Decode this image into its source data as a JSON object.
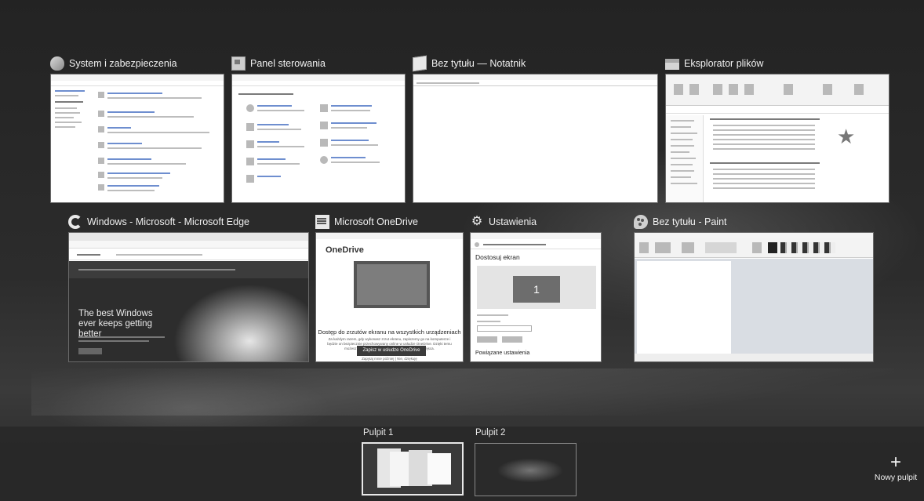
{
  "windows": [
    {
      "title": "System i zabezpieczenia",
      "icon": "shield-icon"
    },
    {
      "title": "Panel sterowania",
      "icon": "control-panel-icon"
    },
    {
      "title": "Bez tytułu — Notatnik",
      "icon": "notepad-icon"
    },
    {
      "title": "Eksplorator plików",
      "icon": "folder-icon"
    },
    {
      "title": "Windows - Microsoft - Microsoft Edge",
      "icon": "edge-icon"
    },
    {
      "title": "Microsoft OneDrive",
      "icon": "onedrive-icon"
    },
    {
      "title": "Ustawienia",
      "icon": "gear-icon"
    },
    {
      "title": "Bez tytułu - Paint",
      "icon": "paint-icon"
    }
  ],
  "edge_thumb": {
    "hero_title": "The best Windows ever keeps getting better"
  },
  "onedrive_thumb": {
    "logo": "OneDrive",
    "heading": "Dostęp do zrzutów ekranu na wszystkich urządzeniach",
    "body": "Za każdym razem, gdy wykonasz zrzut ekranu, zapiszemy go na komputerze i będzie on bezpiecznie przechowywany online w usłudze OneDrive. Dzięki temu możesz uzyskiwać do niego dostęp z dowolnego miejsca.",
    "button": "Zapisz w usłudze OneDrive",
    "footer": "Zapytaj mnie później | Nie, dziękuję"
  },
  "settings_thumb": {
    "heading": "Dostosuj ekran",
    "display_number": "1",
    "subheading": "Powiązane ustawienia"
  },
  "desktops": [
    {
      "label": "Pulpit 1",
      "active": true
    },
    {
      "label": "Pulpit 2",
      "active": false
    }
  ],
  "new_desktop": {
    "label": "Nowy pulpit",
    "icon": "plus-icon"
  }
}
